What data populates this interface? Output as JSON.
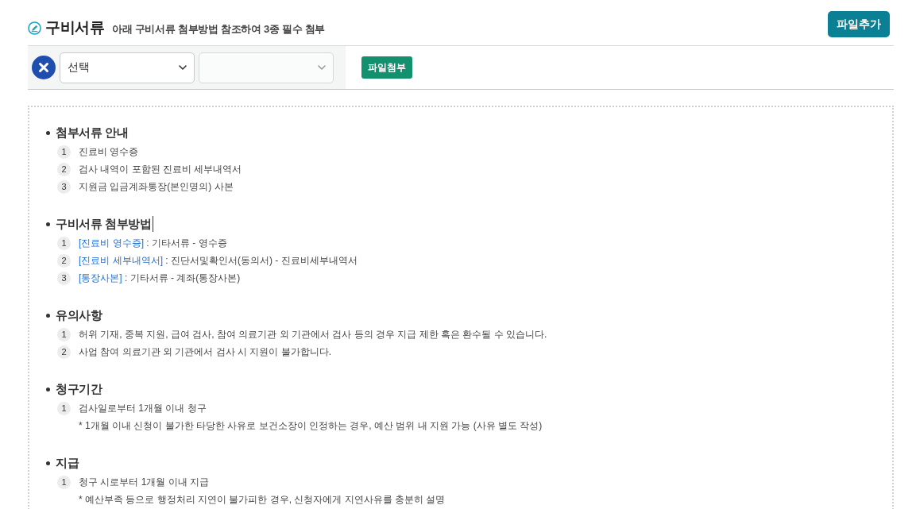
{
  "header": {
    "title": "구비서류",
    "subtitle": "아래 구비서류 첨부방법 참조하여 3종 필수 첨부",
    "add_button": "파일추가"
  },
  "attach_row": {
    "selects": [
      {
        "value": "선택",
        "disabled": false
      },
      {
        "disabled": true
      }
    ],
    "attach_button": "파일첨부"
  },
  "sections": [
    {
      "title": "첨부서류 안내",
      "caret": false,
      "items": [
        {
          "number": "1",
          "text": "진료비 영수증"
        },
        {
          "number": "2",
          "text": "검사 내역이 포함된 진료비 세부내역서"
        },
        {
          "number": "3",
          "text": "지원금 입금계좌통장(본인명의) 사본"
        }
      ]
    },
    {
      "title": "구비서류 첨부방법",
      "caret": true,
      "items": [
        {
          "number": "1",
          "link": "[진료비 영수증]",
          "text": ": 기타서류 - 영수증"
        },
        {
          "number": "2",
          "link": "[진료비 세부내역서]",
          "text": ": 진단서및확인서(동의서) - 진료비세부내역서"
        },
        {
          "number": "3",
          "link": "[통장사본]",
          "text": ": 기타서류 - 계좌(통장사본)"
        }
      ]
    },
    {
      "title": "유의사항",
      "caret": false,
      "items": [
        {
          "number": "1",
          "text": "허위 기재, 중복 지원, 급여 검사, 참여 의료기관 외 기관에서 검사 등의 경우 지급 제한 혹은 환수될 수 있습니다."
        },
        {
          "number": "2",
          "text": "사업 참여 의료기관 외 기관에서 검사 시 지원이 불가합니다."
        }
      ]
    },
    {
      "title": "청구기간",
      "caret": false,
      "items": [
        {
          "number": "1",
          "text": "검사일로부터 1개월 이내 청구",
          "note": "* 1개월 이내 신청이 불가한 타당한 사유로 보건소장이 인정하는 경우, 예산 범위 내 지원 가능 (사유 별도 작성)"
        }
      ]
    },
    {
      "title": "지급",
      "caret": false,
      "items": [
        {
          "number": "1",
          "text": "청구 시로부터 1개월 이내 지급",
          "note": "* 예산부족 등으로 행정처리 지연이 불가피한 경우, 신청자에게 지연사유를 충분히 설명"
        }
      ]
    }
  ]
}
